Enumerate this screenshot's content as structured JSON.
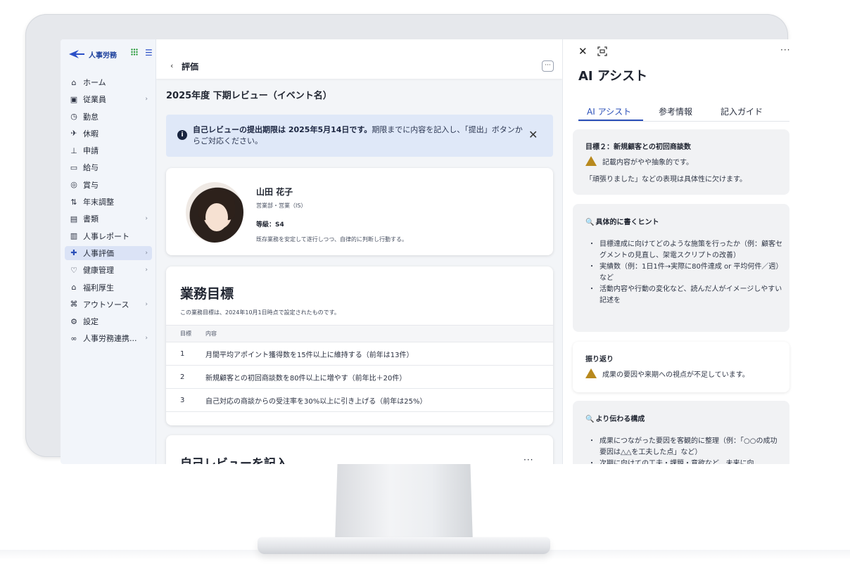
{
  "app": {
    "brand": "人事労務"
  },
  "sidebar": {
    "items": [
      {
        "label": "ホーム",
        "icon": "home-icon",
        "chevron": false,
        "active": false
      },
      {
        "label": "従業員",
        "icon": "employee-icon",
        "chevron": true,
        "active": false
      },
      {
        "label": "勤怠",
        "icon": "clock-icon",
        "chevron": false,
        "active": false
      },
      {
        "label": "休暇",
        "icon": "vacation-icon",
        "chevron": false,
        "active": false
      },
      {
        "label": "申請",
        "icon": "stamp-icon",
        "chevron": false,
        "active": false
      },
      {
        "label": "給与",
        "icon": "wallet-icon",
        "chevron": false,
        "active": false
      },
      {
        "label": "賞与",
        "icon": "bonus-icon",
        "chevron": false,
        "active": false
      },
      {
        "label": "年末調整",
        "icon": "adjust-icon",
        "chevron": false,
        "active": false
      },
      {
        "label": "書類",
        "icon": "document-icon",
        "chevron": true,
        "active": false
      },
      {
        "label": "人事レポート",
        "icon": "report-icon",
        "chevron": false,
        "active": false
      },
      {
        "label": "人事評価",
        "icon": "evaluation-icon",
        "chevron": true,
        "active": true
      },
      {
        "label": "健康管理",
        "icon": "stethoscope-icon",
        "chevron": true,
        "active": false
      },
      {
        "label": "福利厚生",
        "icon": "benefit-icon",
        "chevron": false,
        "active": false
      },
      {
        "label": "アウトソース",
        "icon": "outsource-icon",
        "chevron": true,
        "active": false
      },
      {
        "label": "設定",
        "icon": "gear-icon",
        "chevron": false,
        "active": false
      },
      {
        "label": "人事労務連携...",
        "icon": "link-icon",
        "chevron": true,
        "active": false
      }
    ]
  },
  "header": {
    "title": "評価",
    "more": "···"
  },
  "page": {
    "title": "2025年度 下期レビュー（イベント名）"
  },
  "alert": {
    "bold": "自己レビューの提出期限は 2025年5月14日です。",
    "rest": "期限までに内容を記入し、「提出」ボタンからご対応ください。",
    "close": "✕"
  },
  "profile": {
    "name": "山田 花子",
    "department": "営業部・営業（IS）",
    "grade": "等級：S4",
    "description": "既存業務を安定して遂行しつつ、自律的に判断し行動する。"
  },
  "goals": {
    "title": "業務目標",
    "note": "この業務目標は、2024年10月1日時点で設定されたものです。",
    "columns": [
      "目標",
      "内容"
    ],
    "rows": [
      {
        "no": "1",
        "content": "月間平均アポイント獲得数を15件以上に維持する（前年は13件）"
      },
      {
        "no": "2",
        "content": "新規顧客との初回商談数を80件以上に増やす（前年比＋20件）"
      },
      {
        "no": "3",
        "content": "自己対応の商談からの受注率を30%以上に引き上げる（前年は25%）"
      }
    ]
  },
  "self_review": {
    "title": "自己レビューを記入",
    "more": "···"
  },
  "ai_panel": {
    "close": "✕",
    "more": "···",
    "title": "AI アシスト",
    "tabs": [
      "AI アシスト",
      "参考情報",
      "記入ガイド"
    ],
    "cards": {
      "goal2_heading": "目標２：新規顧客との初回商談数",
      "goal2_warning": "記載内容がやや抽象的です。",
      "goal2_text": "「頑張りました」などの表現は具体性に欠けます。",
      "hint_heading": "具体的に書くヒント",
      "hints": [
        "目標達成に向けてどのような施策を行ったか（例：顧客セグメントの見直し、架電スクリプトの改善）",
        "実績数（例：1日1件→実際に80件達成 or 平均何件／週）など",
        "活動内容や行動の変化など、読んだ人がイメージしやすい記述を"
      ],
      "reflection_heading": "振り返り",
      "reflection_warning": "成果の要因や来期への視点が不足しています。",
      "structure_heading": "より伝わる構成",
      "structure_items": [
        "成果につながった要因を客観的に整理（例：「○○の成功要因は△△を工夫した点」など）",
        "次期に向けての工夫・課題・意欲など、未来に向"
      ]
    }
  },
  "colors": {
    "accent": "#2a4fb8",
    "alert_bg": "#dfe8f8",
    "warning": "#b8891d",
    "sidebar_bg": "#f2f5fa"
  }
}
